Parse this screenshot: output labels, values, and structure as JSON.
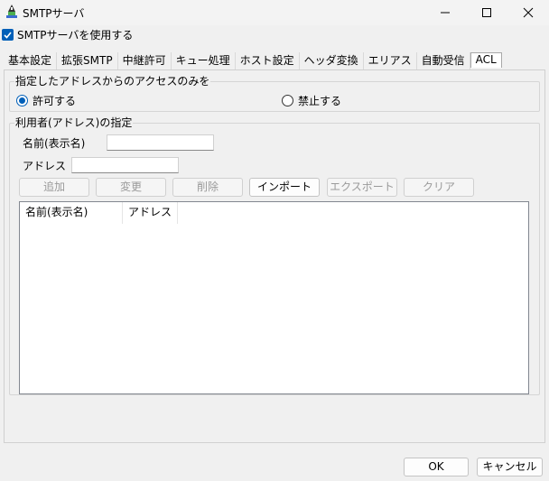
{
  "window": {
    "title": "SMTPサーバ",
    "minimize_icon": "minimize-icon",
    "maximize_icon": "maximize-icon",
    "close_icon": "close-icon"
  },
  "enable_smtp": {
    "label": "SMTPサーバを使用する",
    "checked": true
  },
  "tabs": [
    {
      "label": "基本設定",
      "active": false
    },
    {
      "label": "拡張SMTP",
      "active": false
    },
    {
      "label": "中継許可",
      "active": false
    },
    {
      "label": "キュー処理",
      "active": false
    },
    {
      "label": "ホスト設定",
      "active": false
    },
    {
      "label": "ヘッダ変換",
      "active": false
    },
    {
      "label": "エリアス",
      "active": false
    },
    {
      "label": "自動受信",
      "active": false
    },
    {
      "label": "ACL",
      "active": true
    }
  ],
  "access_group": {
    "legend": "指定したアドレスからのアクセスのみを",
    "allow_label": "許可する",
    "deny_label": "禁止する",
    "selected": "allow"
  },
  "user_group": {
    "legend": "利用者(アドレス)の指定",
    "name_label": "名前(表示名)",
    "name_value": "",
    "address_label": "アドレス",
    "address_value": "",
    "buttons": {
      "add": "追加",
      "change": "変更",
      "delete": "削除",
      "import": "インポート",
      "export": "エクスポート",
      "clear": "クリア"
    },
    "columns": [
      "名前(表示名)",
      "アドレス"
    ],
    "rows": []
  },
  "footer": {
    "ok": "OK",
    "cancel": "キャンセル"
  },
  "colors": {
    "accent": "#005fb8",
    "background": "#f0f0f0"
  }
}
